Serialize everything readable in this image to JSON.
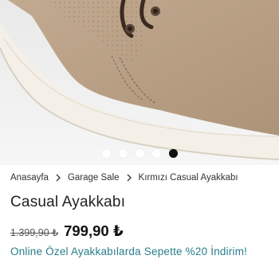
{
  "gallery": {
    "image_alt": "",
    "slide_count": 5,
    "active_slide": 5
  },
  "breadcrumb": {
    "items": [
      "Anasayfa",
      "Garage Sale",
      "Kırmızı Casual Ayakkabı"
    ]
  },
  "product": {
    "title": "Casual Ayakkabı",
    "old_price": "1.399,90 ₺",
    "price": "799,90 ₺",
    "promo_text": "Online Özel Ayakkabılarda Sepette %20 İndirim!"
  },
  "colors": {
    "promo": "#2a7d8c",
    "price": "#111111",
    "active_dot": "#111111",
    "shoe_suede": "#b79f86",
    "sole": "#f4f0e8"
  }
}
